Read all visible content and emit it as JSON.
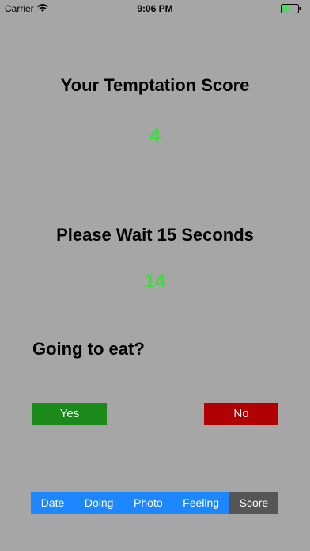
{
  "status_bar": {
    "carrier": "Carrier",
    "time": "9:06 PM",
    "icons": [
      "wifi-icon",
      "battery-icon"
    ],
    "battery_color": "#4cd964"
  },
  "score": {
    "title": "Your Temptation Score",
    "value": "4"
  },
  "wait": {
    "title": "Please Wait 15 Seconds",
    "countdown": "14"
  },
  "question": "Going to eat?",
  "buttons": {
    "yes_label": "Yes",
    "no_label": "No"
  },
  "tabs": [
    {
      "label": "Date"
    },
    {
      "label": "Doing"
    },
    {
      "label": "Photo"
    },
    {
      "label": "Feeling"
    },
    {
      "label": "Score",
      "active": true
    }
  ],
  "colors": {
    "background": "#a6a6a6",
    "accent_green": "#2ee62e",
    "yes_button": "#1a8a1a",
    "no_button": "#b00000",
    "tab_blue": "#1e87ff",
    "tab_active": "#555555"
  }
}
